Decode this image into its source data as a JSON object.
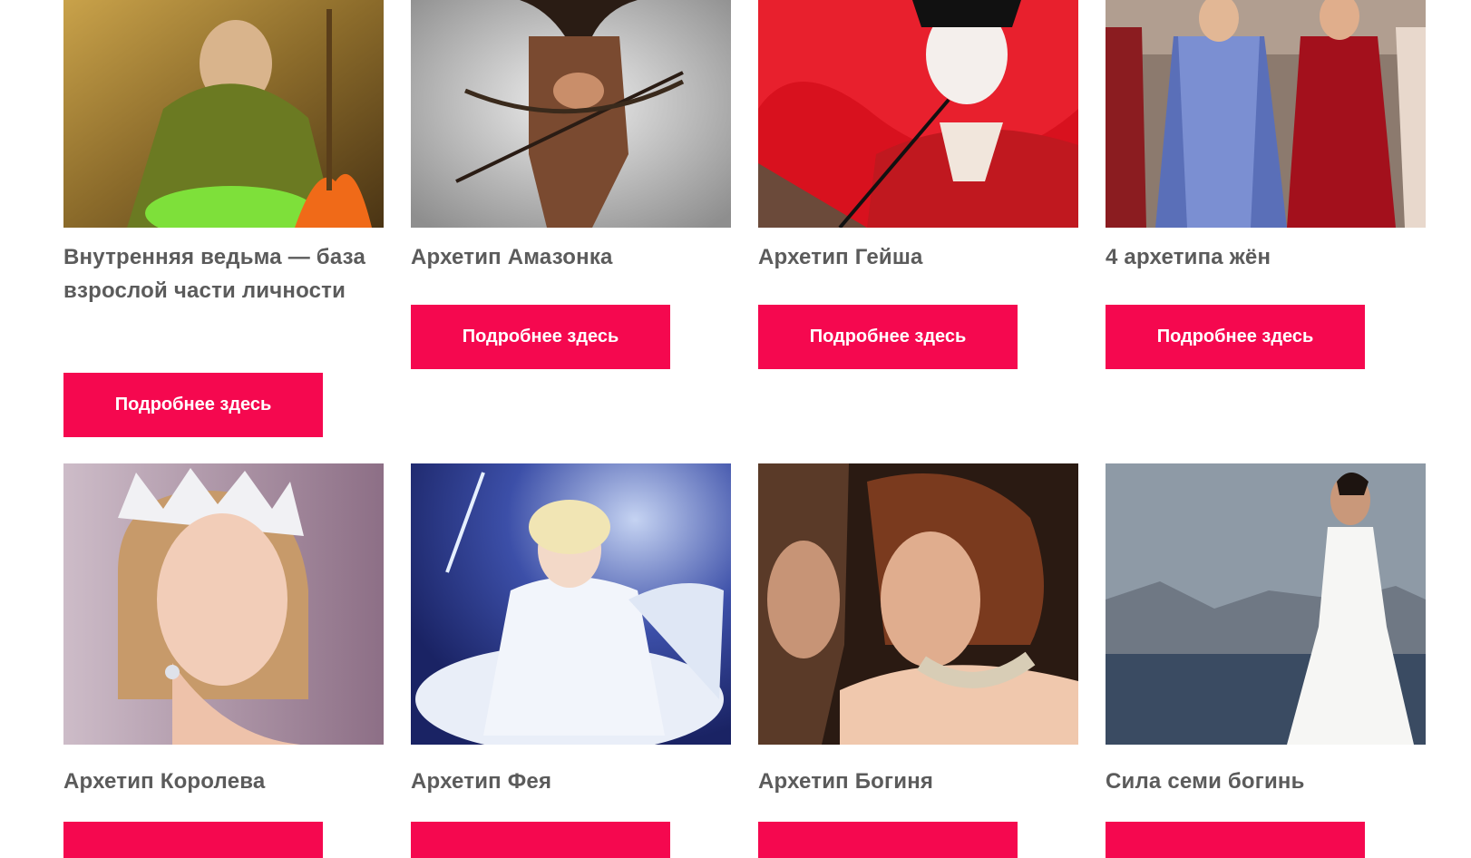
{
  "cards": [
    {
      "title": "Внутренняя ведьма — база взрослой части личности",
      "button": "Подробнее здесь",
      "image": "witch-with-cauldron"
    },
    {
      "title": "Архетип Амазонка",
      "button": "Подробнее здесь",
      "image": "amazon-warrior-with-bow"
    },
    {
      "title": "Архетип Гейша",
      "button": "Подробнее здесь",
      "image": "geisha-with-red-umbrella"
    },
    {
      "title": "4 архетипа жён",
      "button": "Подробнее здесь",
      "image": "women-in-historical-dresses"
    },
    {
      "title": "Архетип Королева",
      "button": "",
      "image": "woman-with-tiara"
    },
    {
      "title": "Архетип Фея",
      "button": "",
      "image": "fairy-godmother-with-wand"
    },
    {
      "title": "Архетип Богиня",
      "button": "",
      "image": "couple-close-up"
    },
    {
      "title": "Сила семи богинь",
      "button": "",
      "image": "woman-in-white-gown-by-sea"
    }
  ],
  "colors": {
    "accent": "#f5084f",
    "title_text": "#5b5b5b"
  }
}
